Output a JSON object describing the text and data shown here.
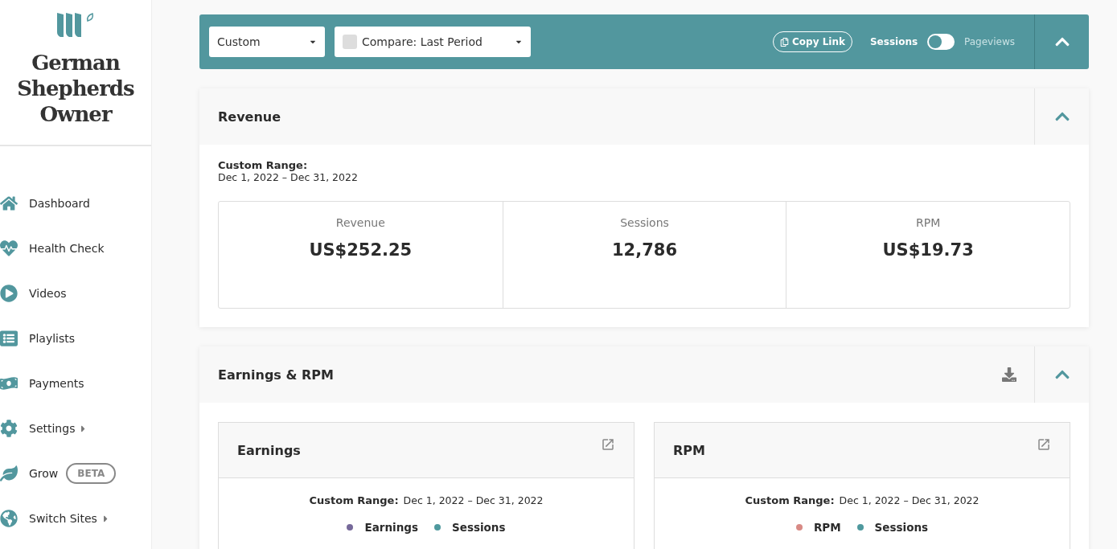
{
  "sidebar": {
    "site_name": "German Shepherds Owner",
    "items": [
      {
        "label": "Dashboard",
        "submenu": false
      },
      {
        "label": "Health Check",
        "submenu": false
      },
      {
        "label": "Videos",
        "submenu": false
      },
      {
        "label": "Playlists",
        "submenu": false
      },
      {
        "label": "Payments",
        "submenu": false
      },
      {
        "label": "Settings",
        "submenu": true
      },
      {
        "label": "Grow",
        "submenu": false,
        "badge": "BETA"
      },
      {
        "label": "Switch Sites",
        "submenu": true
      }
    ]
  },
  "toolbar": {
    "range_select": "Custom",
    "compare_select": "Compare: Last Period",
    "compare_checked": false,
    "copy_link": "Copy Link",
    "metric_options": [
      {
        "label": "Sessions",
        "selected": true
      },
      {
        "label": "Pageviews",
        "selected": false
      }
    ],
    "expanded": true
  },
  "revenue": {
    "title": "Revenue",
    "expanded": true,
    "range_label": "Custom Range:",
    "range_value": "Dec 1, 2022 – Dec 31, 2022",
    "stats": [
      {
        "label": "Revenue",
        "value": "US$252.25"
      },
      {
        "label": "Sessions",
        "value": "12,786"
      },
      {
        "label": "RPM",
        "value": "US$19.73"
      }
    ]
  },
  "earnings_rpm": {
    "title": "Earnings & RPM",
    "expanded": true,
    "panels": [
      {
        "title": "Earnings",
        "range_label": "Custom Range:",
        "range_value": "Dec 1, 2022 – Dec 31, 2022",
        "legend": [
          {
            "label": "Earnings",
            "color": "#76699a"
          },
          {
            "label": "Sessions",
            "color": "#4f999e"
          }
        ]
      },
      {
        "title": "RPM",
        "range_label": "Custom Range:",
        "range_value": "Dec 1, 2022 – Dec 31, 2022",
        "legend": [
          {
            "label": "RPM",
            "color": "#d88a85"
          },
          {
            "label": "Sessions",
            "color": "#4f999e"
          }
        ]
      }
    ]
  }
}
